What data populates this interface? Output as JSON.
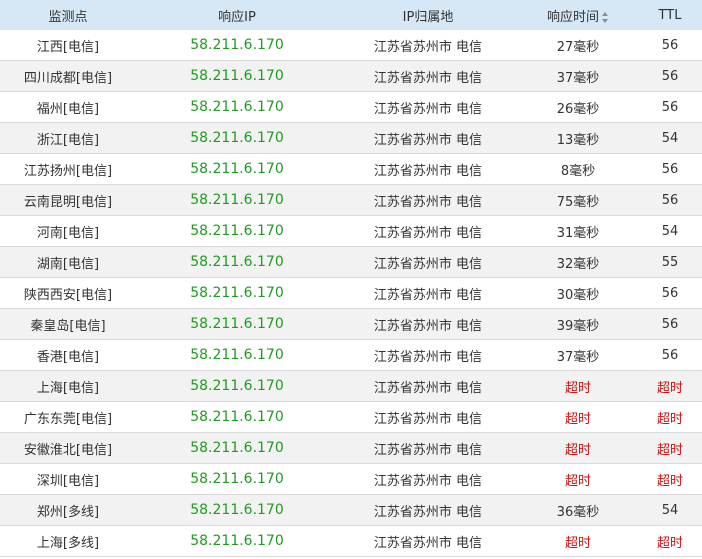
{
  "header": {
    "col_location": "监测点",
    "col_ip": "响应IP",
    "col_geo": "IP归属地",
    "col_time": "响应时间",
    "col_ttl": "TTL",
    "sort_icon": "sort-icon"
  },
  "colors": {
    "ip": "#1f9c1f",
    "timeout": "#d01010",
    "header_bg": "#d6e8f6"
  },
  "rows": [
    {
      "location": "江西[电信]",
      "ip": "58.211.6.170",
      "geo": "江苏省苏州市 电信",
      "time": "27毫秒",
      "ttl": "56"
    },
    {
      "location": "四川成都[电信]",
      "ip": "58.211.6.170",
      "geo": "江苏省苏州市 电信",
      "time": "37毫秒",
      "ttl": "56"
    },
    {
      "location": "福州[电信]",
      "ip": "58.211.6.170",
      "geo": "江苏省苏州市 电信",
      "time": "26毫秒",
      "ttl": "56"
    },
    {
      "location": "浙江[电信]",
      "ip": "58.211.6.170",
      "geo": "江苏省苏州市 电信",
      "time": "13毫秒",
      "ttl": "54"
    },
    {
      "location": "江苏扬州[电信]",
      "ip": "58.211.6.170",
      "geo": "江苏省苏州市 电信",
      "time": "8毫秒",
      "ttl": "56"
    },
    {
      "location": "云南昆明[电信]",
      "ip": "58.211.6.170",
      "geo": "江苏省苏州市 电信",
      "time": "75毫秒",
      "ttl": "56"
    },
    {
      "location": "河南[电信]",
      "ip": "58.211.6.170",
      "geo": "江苏省苏州市 电信",
      "time": "31毫秒",
      "ttl": "54"
    },
    {
      "location": "湖南[电信]",
      "ip": "58.211.6.170",
      "geo": "江苏省苏州市 电信",
      "time": "32毫秒",
      "ttl": "55"
    },
    {
      "location": "陕西西安[电信]",
      "ip": "58.211.6.170",
      "geo": "江苏省苏州市 电信",
      "time": "30毫秒",
      "ttl": "56"
    },
    {
      "location": "秦皇岛[电信]",
      "ip": "58.211.6.170",
      "geo": "江苏省苏州市 电信",
      "time": "39毫秒",
      "ttl": "56"
    },
    {
      "location": "香港[电信]",
      "ip": "58.211.6.170",
      "geo": "江苏省苏州市 电信",
      "time": "37毫秒",
      "ttl": "56"
    },
    {
      "location": "上海[电信]",
      "ip": "58.211.6.170",
      "geo": "江苏省苏州市 电信",
      "time": "超时",
      "ttl": "超时"
    },
    {
      "location": "广东东莞[电信]",
      "ip": "58.211.6.170",
      "geo": "江苏省苏州市 电信",
      "time": "超时",
      "ttl": "超时"
    },
    {
      "location": "安徽淮北[电信]",
      "ip": "58.211.6.170",
      "geo": "江苏省苏州市 电信",
      "time": "超时",
      "ttl": "超时"
    },
    {
      "location": "深圳[电信]",
      "ip": "58.211.6.170",
      "geo": "江苏省苏州市 电信",
      "time": "超时",
      "ttl": "超时"
    },
    {
      "location": "郑州[多线]",
      "ip": "58.211.6.170",
      "geo": "江苏省苏州市 电信",
      "time": "36毫秒",
      "ttl": "54"
    },
    {
      "location": "上海[多线]",
      "ip": "58.211.6.170",
      "geo": "江苏省苏州市 电信",
      "time": "超时",
      "ttl": "超时"
    }
  ]
}
